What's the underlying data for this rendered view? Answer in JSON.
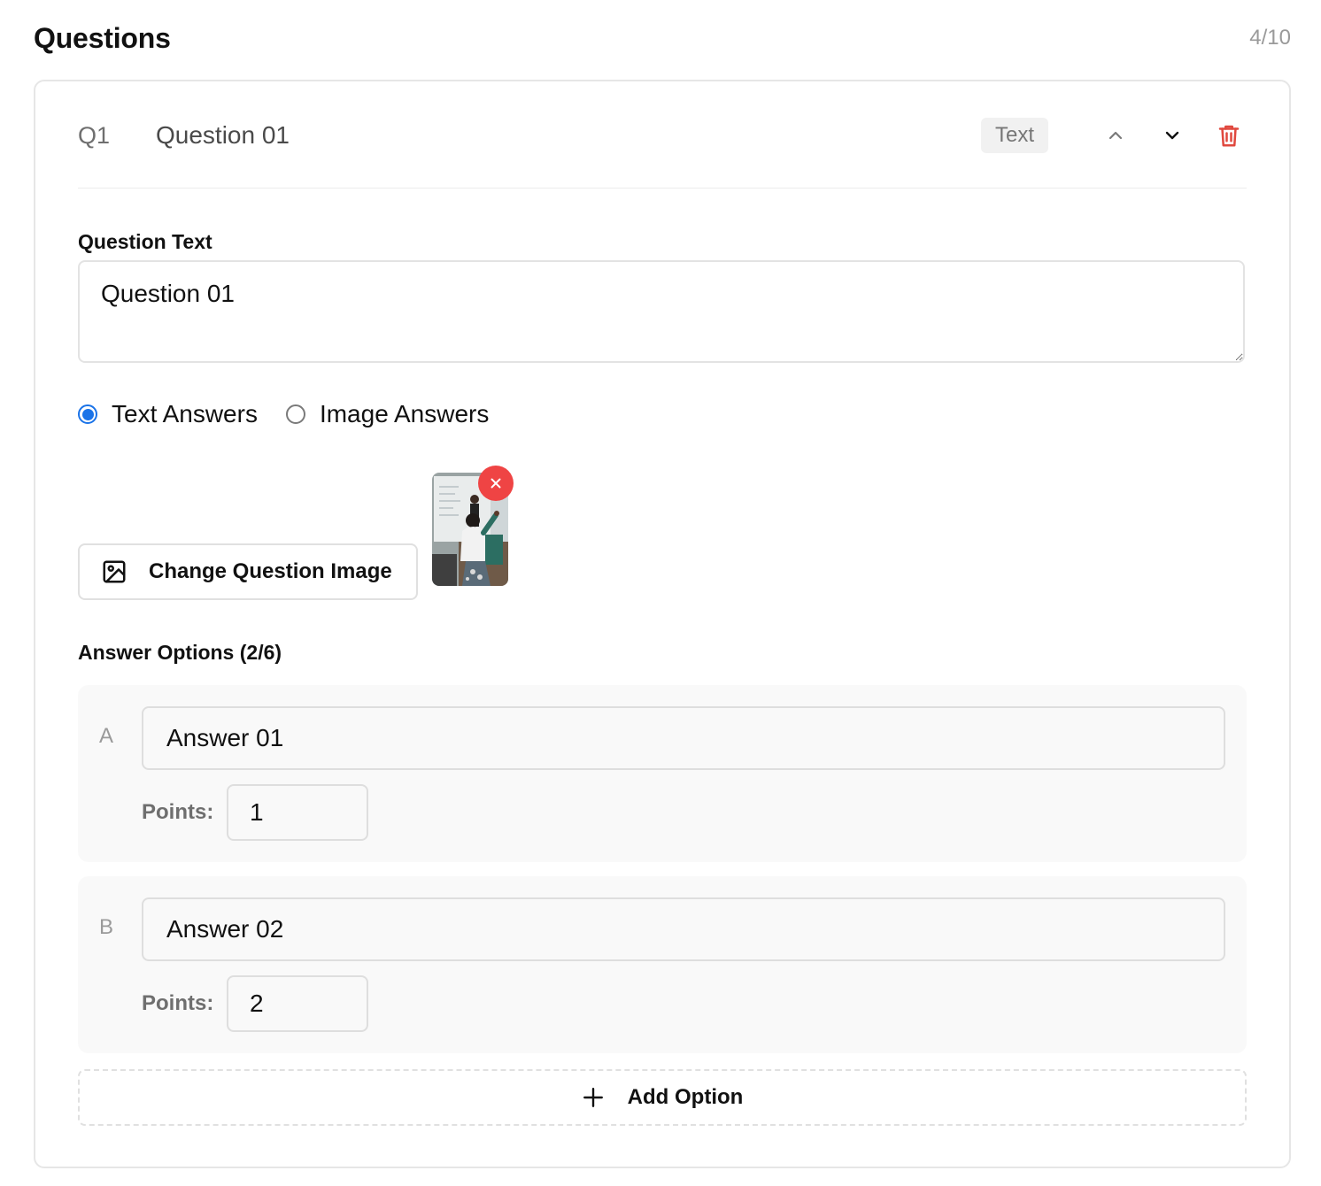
{
  "header": {
    "title": "Questions",
    "count": "4/10"
  },
  "question": {
    "number": "Q1",
    "title": "Question 01",
    "type_badge": "Text",
    "question_text_label": "Question Text",
    "question_text_value": "Question 01",
    "answer_modes": [
      {
        "label": "Text Answers",
        "selected": true
      },
      {
        "label": "Image Answers",
        "selected": false
      }
    ],
    "change_image_label": "Change Question Image",
    "answer_options_label": "Answer Options (2/6)",
    "options": [
      {
        "letter": "A",
        "answer": "Answer 01",
        "points_label": "Points:",
        "points": "1"
      },
      {
        "letter": "B",
        "answer": "Answer 02",
        "points_label": "Points:",
        "points": "2"
      }
    ],
    "add_option_label": "Add Option"
  },
  "colors": {
    "accent": "#1a73e8",
    "danger": "#ef4444",
    "delete_icon": "#e0483e"
  },
  "icons": {
    "move_up": "chevron-up-icon",
    "move_down": "chevron-down-icon",
    "delete": "trash-icon",
    "image": "image-icon",
    "remove": "close-icon",
    "add": "plus-icon"
  }
}
